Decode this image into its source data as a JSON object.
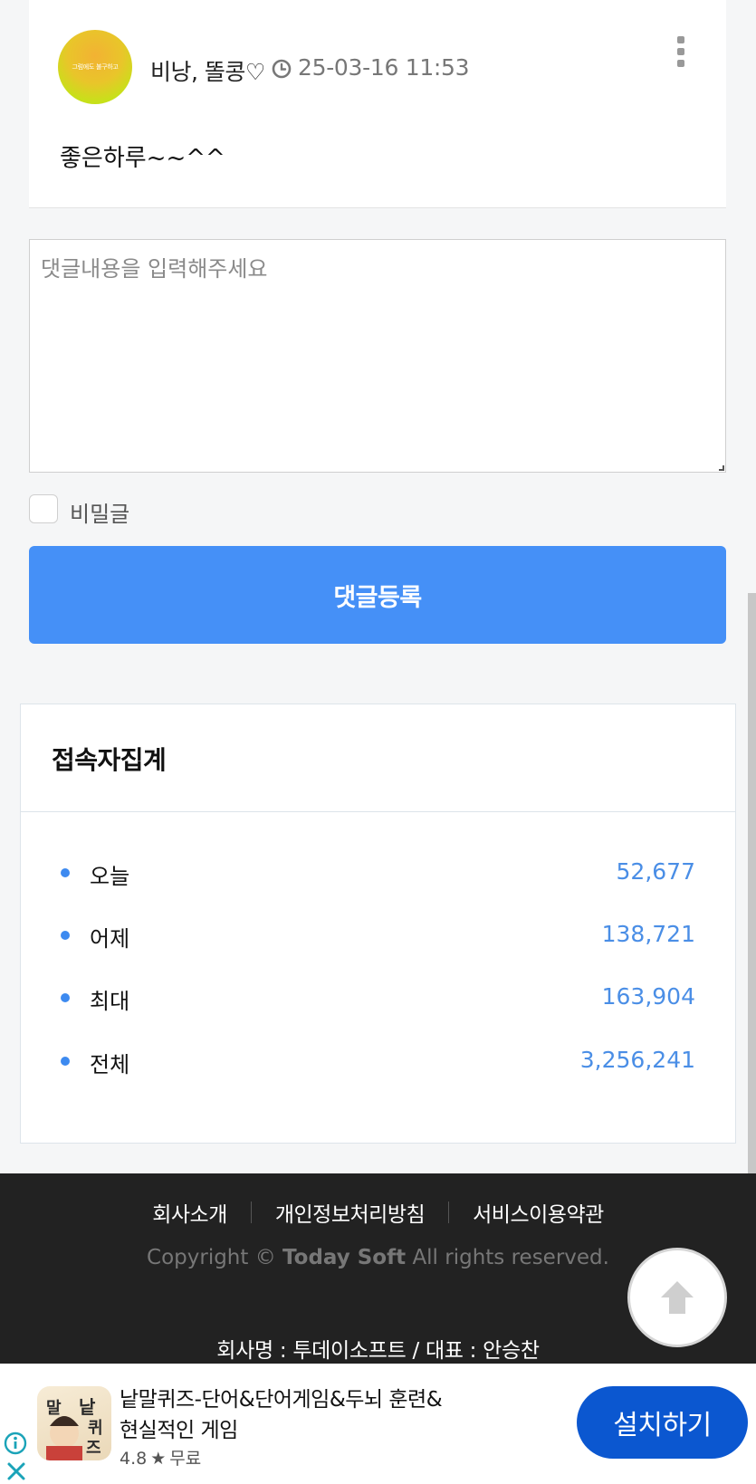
{
  "comment": {
    "avatar_text": "그럼에도 불구하고",
    "author": "비낭, 똘콩♡",
    "timestamp": "25-03-16 11:53",
    "body": "좋은하루~~^^"
  },
  "comment_form": {
    "placeholder": "댓글내용을 입력해주세요",
    "secret_label": "비밀글",
    "submit_label": "댓글등록"
  },
  "visitor_stats": {
    "title": "접속자집계",
    "rows": [
      {
        "label": "오늘",
        "value": "52,677"
      },
      {
        "label": "어제",
        "value": "138,721"
      },
      {
        "label": "최대",
        "value": "163,904"
      },
      {
        "label": "전체",
        "value": "3,256,241"
      }
    ]
  },
  "footer": {
    "links": [
      "회사소개",
      "개인정보처리방침",
      "서비스이용약관"
    ],
    "copyright_prefix": "Copyright ©",
    "copyright_brand": "Today Soft",
    "copyright_suffix": "All rights reserved.",
    "company_info": "회사명 : 투데이소프트 / 대표 : 안승찬"
  },
  "ad": {
    "app_icon_text": "낱말퀴즈",
    "title_line1": "낱말퀴즈-단어&단어게임&두뇌 훈련&",
    "title_line2": "현실적인 게임",
    "rating": "4.8",
    "price": "무료",
    "install_label": "설치하기"
  },
  "colors": {
    "accent": "#4590f7",
    "stat_value": "#4a8ee6",
    "footer_bg": "#222222",
    "install_button": "#0b57d0"
  }
}
